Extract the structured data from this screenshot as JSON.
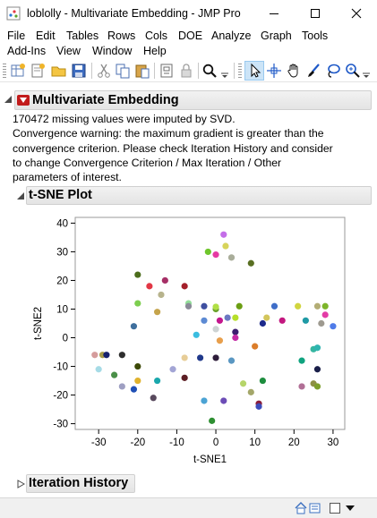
{
  "window": {
    "title": "loblolly - Multivariate Embedding - JMP Pro",
    "minimize_glyph": "—",
    "maximize_glyph": "☐",
    "close_glyph": "✕"
  },
  "menu": {
    "items": [
      "File",
      "Edit",
      "Tables",
      "Rows",
      "Cols",
      "DOE",
      "Analyze",
      "Graph",
      "Tools",
      "Add-Ins",
      "View",
      "Window",
      "Help"
    ]
  },
  "toolbar": {
    "icons": [
      "new-data-table-icon",
      "new-script-icon",
      "open-file-icon",
      "save-icon",
      "cut-icon",
      "copy-icon",
      "paste-icon",
      "journal-icon",
      "lock-icon",
      "search-icon",
      "arrow-select-icon",
      "crosshair-icon",
      "hand-grabber-icon",
      "brush-icon",
      "lasso-icon",
      "magnifier-icon"
    ]
  },
  "report": {
    "title": "Multivariate Embedding",
    "message_lines": [
      "170472 missing values were imputed by SVD.",
      "Convergence warning: the maximum gradient is greater than the",
      "convergence criterion. Please check Iteration History and consider",
      "to change Convergence Criterion / Max Iteration / Other",
      "parameters of interest."
    ],
    "plot_title": "t-SNE Plot",
    "iteration_history_title": "Iteration History"
  },
  "chart_data": {
    "type": "scatter",
    "title": "t-SNE Plot",
    "xlabel": "t-SNE1",
    "ylabel": "t-SNE2",
    "xlim": [
      -36,
      33
    ],
    "ylim": [
      -32,
      42
    ],
    "xticks": [
      -30,
      -20,
      -10,
      0,
      10,
      20,
      30
    ],
    "yticks": [
      -30,
      -20,
      -10,
      0,
      10,
      20,
      30,
      40
    ],
    "grid": false,
    "points": [
      {
        "x": 2,
        "y": 36,
        "color": "#c46ee8"
      },
      {
        "x": -2,
        "y": 30,
        "color": "#6fc62c"
      },
      {
        "x": 0,
        "y": 29,
        "color": "#e63aa3"
      },
      {
        "x": 2.5,
        "y": 32,
        "color": "#d7d45a"
      },
      {
        "x": 4,
        "y": 28,
        "color": "#a9ad9a"
      },
      {
        "x": 9,
        "y": 26,
        "color": "#596f22"
      },
      {
        "x": -20,
        "y": 22,
        "color": "#4c6d1c"
      },
      {
        "x": -17,
        "y": 18,
        "color": "#e23745"
      },
      {
        "x": -13,
        "y": 20,
        "color": "#a62f66"
      },
      {
        "x": -14,
        "y": 15,
        "color": "#b7b38d"
      },
      {
        "x": -8,
        "y": 18,
        "color": "#a4202a"
      },
      {
        "x": -20,
        "y": 12,
        "color": "#7dce4f"
      },
      {
        "x": -15,
        "y": 9,
        "color": "#c5a44c"
      },
      {
        "x": -21,
        "y": 4,
        "color": "#3f6f9d"
      },
      {
        "x": -7,
        "y": 12,
        "color": "#93de9a"
      },
      {
        "x": -7,
        "y": 11,
        "color": "#8b8a98"
      },
      {
        "x": -3,
        "y": 11,
        "color": "#3f4fa0"
      },
      {
        "x": 0,
        "y": 10,
        "color": "#6aa02b"
      },
      {
        "x": 0,
        "y": 10.8,
        "color": "#b0df45"
      },
      {
        "x": 6,
        "y": 11,
        "color": "#6b9e13"
      },
      {
        "x": 15,
        "y": 11,
        "color": "#3f6ec8"
      },
      {
        "x": 13,
        "y": 7,
        "color": "#d3c65c"
      },
      {
        "x": 21,
        "y": 11,
        "color": "#d1d53f"
      },
      {
        "x": 26,
        "y": 11,
        "color": "#b3ad75"
      },
      {
        "x": 28,
        "y": 11,
        "color": "#7db52a"
      },
      {
        "x": 28,
        "y": 8,
        "color": "#e33ba6"
      },
      {
        "x": 23,
        "y": 6,
        "color": "#1f9aa5"
      },
      {
        "x": 27,
        "y": 5,
        "color": "#9e9a90"
      },
      {
        "x": 30,
        "y": 4,
        "color": "#4f7be8"
      },
      {
        "x": 17,
        "y": 6,
        "color": "#c3177f"
      },
      {
        "x": 12,
        "y": 5,
        "color": "#1d2a8b"
      },
      {
        "x": 5,
        "y": 7,
        "color": "#b6df2a"
      },
      {
        "x": 3,
        "y": 7,
        "color": "#6c78c2"
      },
      {
        "x": -3,
        "y": 6,
        "color": "#5c8ad3"
      },
      {
        "x": 1,
        "y": 6,
        "color": "#c4168e"
      },
      {
        "x": 0,
        "y": 3,
        "color": "#cdd3d3"
      },
      {
        "x": 5,
        "y": 2,
        "color": "#3c1c6e"
      },
      {
        "x": 5,
        "y": 0,
        "color": "#c32aa4"
      },
      {
        "x": -5,
        "y": 1,
        "color": "#3bbde0"
      },
      {
        "x": 1,
        "y": -1,
        "color": "#e89f4c"
      },
      {
        "x": 10,
        "y": -3,
        "color": "#db7d2b"
      },
      {
        "x": 25,
        "y": -4,
        "color": "#36b6a0"
      },
      {
        "x": 26,
        "y": -3.5,
        "color": "#2fb5b0"
      },
      {
        "x": -24,
        "y": -6,
        "color": "#2d2d2d"
      },
      {
        "x": -31,
        "y": -6,
        "color": "#d59c9c"
      },
      {
        "x": -29,
        "y": -6,
        "color": "#a69a47"
      },
      {
        "x": -28,
        "y": -6,
        "color": "#16216e"
      },
      {
        "x": -30,
        "y": -11,
        "color": "#a6dbe6"
      },
      {
        "x": -8,
        "y": -7,
        "color": "#e7cd97"
      },
      {
        "x": 0,
        "y": -7,
        "color": "#2e1d3a"
      },
      {
        "x": -4,
        "y": -7,
        "color": "#20398b"
      },
      {
        "x": 4,
        "y": -8,
        "color": "#5a97c2"
      },
      {
        "x": 22,
        "y": -8,
        "color": "#10a37f"
      },
      {
        "x": -20,
        "y": -10,
        "color": "#3d4a08"
      },
      {
        "x": -11,
        "y": -11,
        "color": "#a3a5d5"
      },
      {
        "x": -8,
        "y": -14,
        "color": "#5c1e24"
      },
      {
        "x": -15,
        "y": -15,
        "color": "#1aa7ac"
      },
      {
        "x": -20,
        "y": -15,
        "color": "#e0b22d"
      },
      {
        "x": -26,
        "y": -13,
        "color": "#4a8f48"
      },
      {
        "x": -24,
        "y": -17,
        "color": "#9e9fc2"
      },
      {
        "x": -21,
        "y": -18,
        "color": "#1f4fb5"
      },
      {
        "x": -16,
        "y": -21,
        "color": "#58495d"
      },
      {
        "x": 7,
        "y": -16,
        "color": "#b6d56a"
      },
      {
        "x": 9,
        "y": -19,
        "color": "#a4a76a"
      },
      {
        "x": 12,
        "y": -15,
        "color": "#1d8d3e"
      },
      {
        "x": 25,
        "y": -16,
        "color": "#8e9045"
      },
      {
        "x": 26,
        "y": -17,
        "color": "#7d9e2b"
      },
      {
        "x": 22,
        "y": -17,
        "color": "#b16f96"
      },
      {
        "x": 26,
        "y": -11,
        "color": "#1a1f49"
      },
      {
        "x": -3,
        "y": -22,
        "color": "#4ba3d4"
      },
      {
        "x": 2,
        "y": -22,
        "color": "#6c4cb6"
      },
      {
        "x": 11,
        "y": -23,
        "color": "#8a1e3c"
      },
      {
        "x": 11,
        "y": -24,
        "color": "#3d4cbb"
      },
      {
        "x": -1,
        "y": -29,
        "color": "#2e8f32"
      }
    ]
  }
}
